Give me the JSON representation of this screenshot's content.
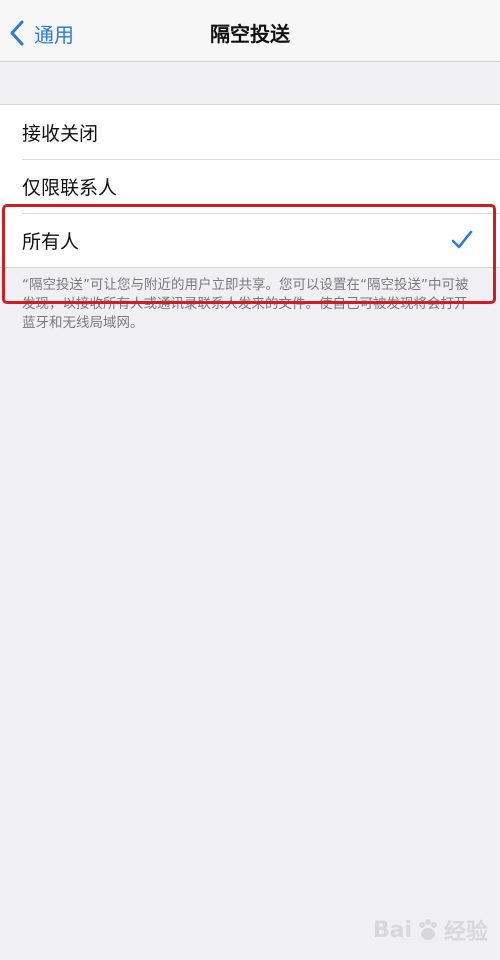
{
  "navbar": {
    "back_label": "通用",
    "title": "隔空投送"
  },
  "options": [
    {
      "label": "接收关闭",
      "selected": false
    },
    {
      "label": "仅限联系人",
      "selected": false
    },
    {
      "label": "所有人",
      "selected": true
    }
  ],
  "footer_note": "“隔空投送”可让您与附近的用户立即共享。您可以设置在“隔空投送”中可被发现，以接收所有人或通讯录联系人发来的文件。使自己可被发现将会打开蓝牙和无线局域网。",
  "watermark": {
    "prefix": "Bai",
    "suffix": "经验"
  },
  "colors": {
    "accent": "#2b7ae0",
    "highlight": "#d11c24"
  }
}
